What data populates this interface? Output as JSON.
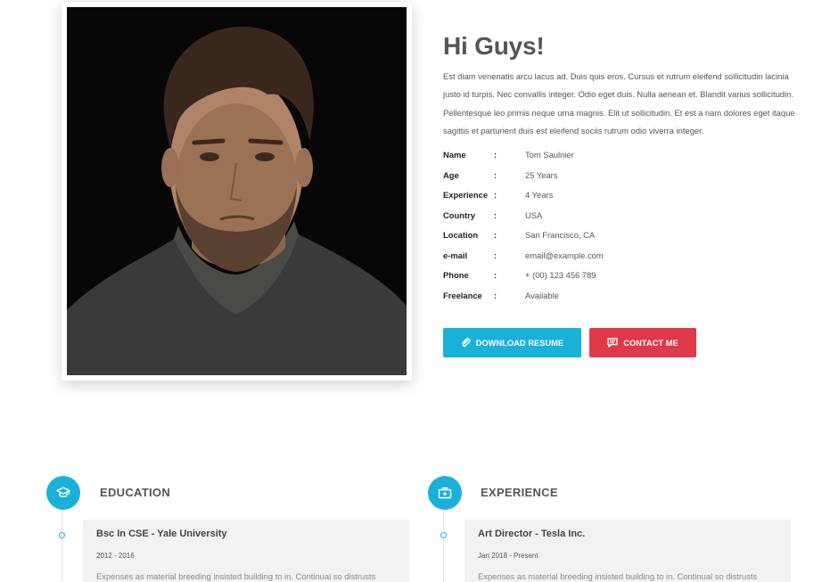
{
  "about": {
    "greeting": "Hi Guys!",
    "description": "Est diam venenatis arcu lacus ad. Duis quis eros. Cursus et rutrum eleifend sollicitudin lacinia justo id turpis. Nec convallis integer. Odio eget duis. Nulla aenean et. Blandit varius sollicitudin. Pellentesque leo primis neque urna magnis. Elit ut sollicitudin. Et est a nam dolores eget itaque sagittis et parturient duis est eleifend sociis rutrum odio viverra integer."
  },
  "info": [
    {
      "key": "Name",
      "value": "Tom Saulnier"
    },
    {
      "key": "Age",
      "value": "25 Years"
    },
    {
      "key": "Experience",
      "value": "4 Years"
    },
    {
      "key": "Country",
      "value": "USA"
    },
    {
      "key": "Location",
      "value": "San Francisco, CA"
    },
    {
      "key": "e-mail",
      "value": "email@example.com"
    },
    {
      "key": "Phone",
      "value": "+ (00) 123 456 789"
    },
    {
      "key": "Freelance",
      "value": "Available"
    }
  ],
  "colon": ":",
  "buttons": {
    "download": "DOWNLOAD RESUME",
    "contact": "CONTACT ME"
  },
  "education": {
    "title": "EDUCATION",
    "icon": "graduation-cap-icon",
    "item": {
      "title": "Bsc In CSE - Yale University",
      "date": "2012 - 2016",
      "text": "Expenses as material breeding insisted building to in. Continual so distrusts"
    }
  },
  "experience": {
    "title": "EXPERIENCE",
    "icon": "briefcase-icon",
    "item": {
      "title": "Art Director - Tesla Inc.",
      "date": "Jan 2018 - Present",
      "text": "Expenses as material breeding insisted building to in. Continual so distrusts"
    }
  },
  "colors": {
    "accent": "#1ab1d9",
    "danger": "#e0394a",
    "card": "#f2f2f2"
  }
}
